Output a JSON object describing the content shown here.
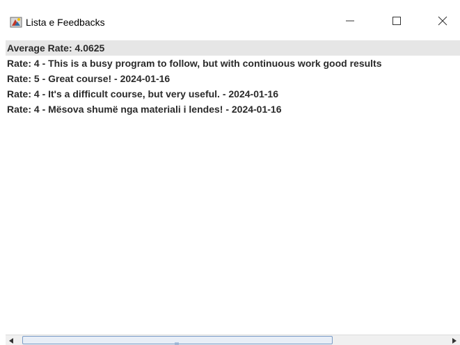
{
  "window": {
    "title": "Lista e Feedbacks"
  },
  "icons": {
    "app": "java-app-icon",
    "minimize": "minimize-icon",
    "maximize": "maximize-icon",
    "close": "close-icon",
    "scroll_left": "arrow-left-icon",
    "scroll_right": "arrow-right-icon"
  },
  "feedback_list": {
    "average": "Average Rate: 4.0625",
    "items": [
      "Rate: 4 - This is a busy program to follow, but with continuous work good results",
      "Rate: 5 - Great course! - 2024-01-16",
      "Rate: 4 - It's a difficult course, but very useful. - 2024-01-16",
      "Rate: 4 - Mësova shumë nga materiali i lendes! - 2024-01-16"
    ]
  },
  "colors": {
    "selected_row": "#e6e6e6",
    "scroll_thumb_border": "#7a9cc7"
  }
}
